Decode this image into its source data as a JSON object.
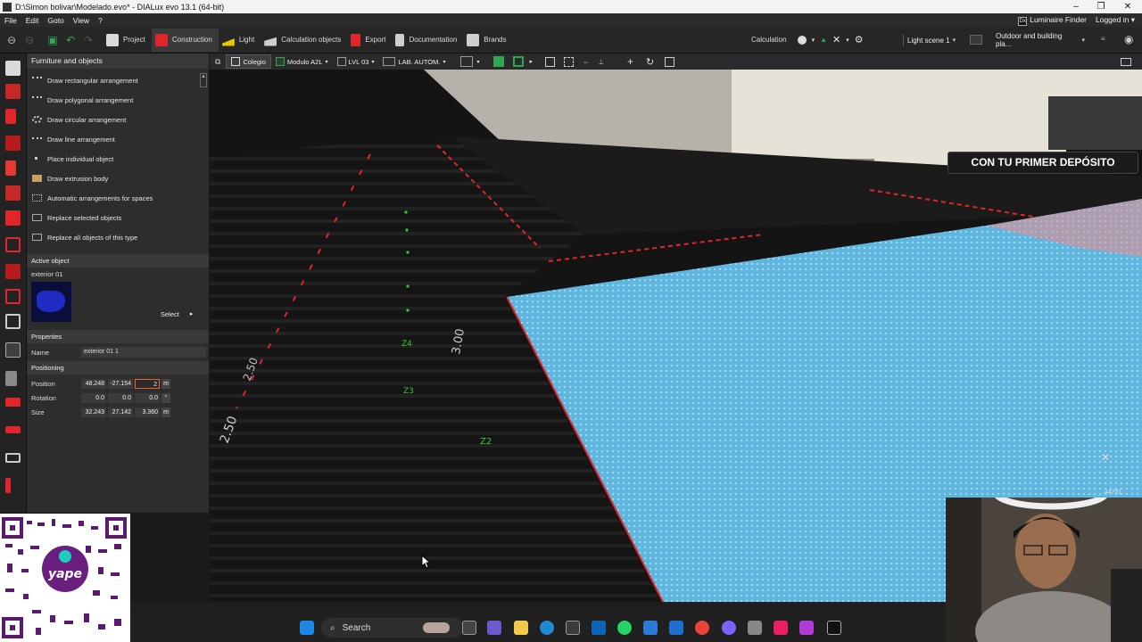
{
  "window": {
    "title": "D:\\Simon bolivar\\Modelado.evo* - DIALux evo 13.1  (64-bit)",
    "minimize": "–",
    "maximize": "❐",
    "close": "✕"
  },
  "menubar": {
    "items": [
      "File",
      "Edit",
      "Goto",
      "View",
      "?"
    ],
    "luminaire_finder": "Luminaire Finder",
    "logged_in": "Logged in"
  },
  "toolbar": {
    "tabs": [
      {
        "label": "Project",
        "color": "#d9d9d9"
      },
      {
        "label": "Construction",
        "color": "#e0262b"
      },
      {
        "label": "Light",
        "color": "#e8c600"
      },
      {
        "label": "Calculation objects",
        "color": "#cfcfcf"
      },
      {
        "label": "Export",
        "color": "#e0262b"
      },
      {
        "label": "Documentation",
        "color": "#cfcfcf"
      },
      {
        "label": "Brands",
        "color": "#cfcfcf"
      }
    ],
    "active_tab": "Construction",
    "calculation_label": "Calculation",
    "light_scene": "Light scene 1",
    "outdoor_dropdown": "Outdoor and building pla..."
  },
  "subtoolbar": {
    "items": [
      {
        "label": "Colegio"
      },
      {
        "label": "Modulo A2L"
      },
      {
        "label": "LVL 03"
      },
      {
        "label": "LAB. AUTOM."
      }
    ]
  },
  "left_panel": {
    "header": "Furniture and objects",
    "tools": [
      "Draw rectangular arrangement",
      "Draw polygonal arrangement",
      "Draw circular arrangement",
      "Draw line arrangement",
      "Place individual object",
      "Draw extrusion body",
      "Automatic arrangements for spaces",
      "Replace selected objects",
      "Replace all objects of this type"
    ],
    "active_object": {
      "header": "Active object",
      "name": "exterior 01",
      "select_label": "Select"
    },
    "properties": {
      "header": "Properties",
      "name_label": "Name",
      "name_value": "exterior 01 1"
    },
    "positioning": {
      "header": "Positioning",
      "position_label": "Position",
      "position": [
        "48.248",
        "-27.154",
        "2"
      ],
      "position_unit": "m",
      "rotation_label": "Rotation",
      "rotation": [
        "0.0",
        "0.0",
        "0.0"
      ],
      "rotation_unit": "°",
      "size_label": "Size",
      "size": [
        "32.243",
        "27.142",
        "3.360"
      ],
      "size_unit": "m"
    }
  },
  "viewport": {
    "banner": "CON TU PRIMER DEPÓSITO",
    "corner_number": "44701"
  },
  "taskbar": {
    "search_label": "Search"
  },
  "colors": {
    "accent_red": "#e0262b",
    "floor_blue": "#5fb6de",
    "label_green": "#33cc33"
  }
}
